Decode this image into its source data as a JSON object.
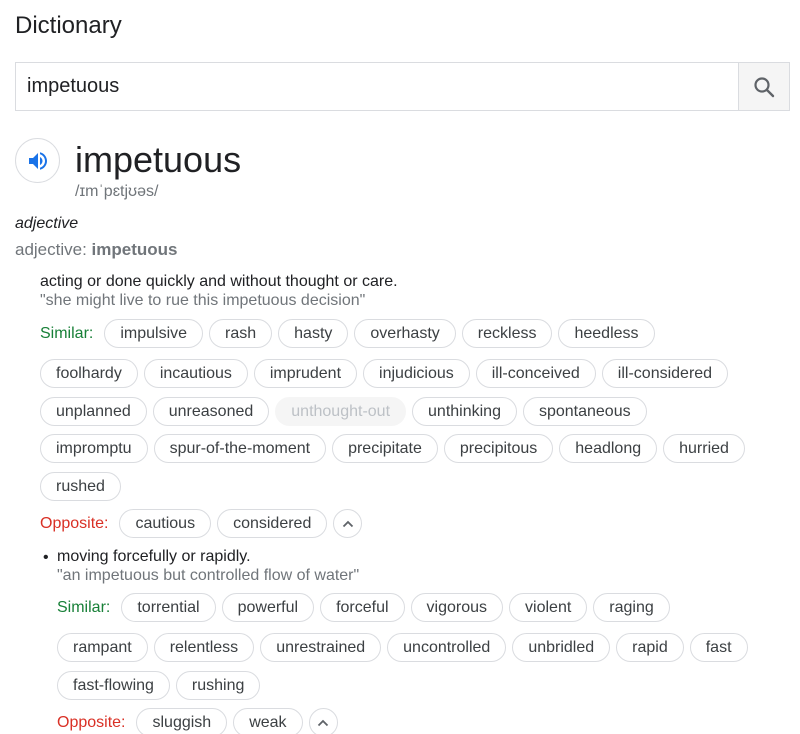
{
  "header": {
    "title": "Dictionary"
  },
  "search": {
    "value": "impetuous",
    "button_icon": "search-icon"
  },
  "entry": {
    "word": "impetuous",
    "phonetic": "/ɪmˈpɛtjʊəs/",
    "part_of_speech": "adjective",
    "pos_prefix": "adjective: ",
    "pos_word": "impetuous"
  },
  "sense1": {
    "definition": "acting or done quickly and without thought or care.",
    "example": "\"she might live to rue this impetuous decision\"",
    "similar_label": "Similar:",
    "similar": [
      "impulsive",
      "rash",
      "hasty",
      "overhasty",
      "reckless",
      "heedless",
      "foolhardy",
      "incautious",
      "imprudent",
      "injudicious",
      "ill-conceived",
      "ill-considered",
      "unplanned",
      "unreasoned",
      "unthought-out",
      "unthinking",
      "spontaneous",
      "impromptu",
      "spur-of-the-moment",
      "precipitate",
      "precipitous",
      "headlong",
      "hurried",
      "rushed"
    ],
    "opposite_label": "Opposite:",
    "opposite": [
      "cautious",
      "considered"
    ]
  },
  "sense2": {
    "bullet": "•",
    "definition": "moving forcefully or rapidly.",
    "example": "\"an impetuous but controlled flow of water\"",
    "similar_label": "Similar:",
    "similar": [
      "torrential",
      "powerful",
      "forceful",
      "vigorous",
      "violent",
      "raging",
      "rampant",
      "relentless",
      "unrestrained",
      "uncontrolled",
      "unbridled",
      "rapid",
      "fast",
      "fast-flowing",
      "rushing"
    ],
    "opposite_label": "Opposite:",
    "opposite": [
      "sluggish",
      "weak"
    ]
  },
  "colors": {
    "similar": "#188038",
    "opposite": "#d93025",
    "icon_blue": "#1a73e8"
  }
}
